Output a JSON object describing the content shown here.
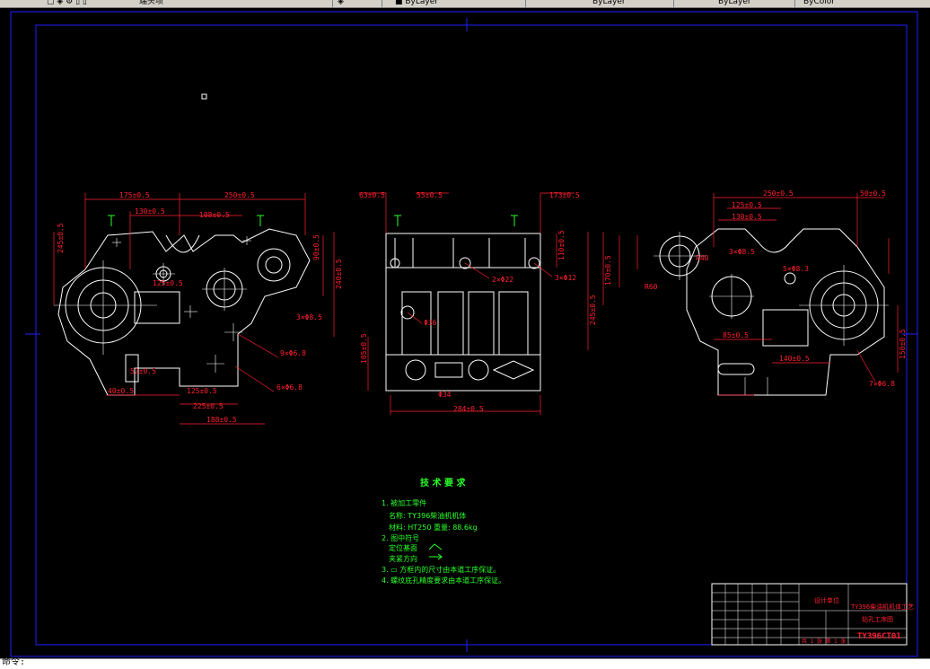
{
  "toolbar": {
    "items": [
      "▢ ◈ ⚙ ▯ ▯",
      "端头项",
      "◈",
      "■ ByLayer",
      "ByLayer",
      "ByLayer",
      "ByColor"
    ]
  },
  "command_line": {
    "prompt": "命令:"
  },
  "drawing": {
    "colors": {
      "outline": "#ffffff",
      "dimension": "#ff2030",
      "center": "#ffffff",
      "tech": "#28ff28",
      "frame": "#2020ff"
    },
    "view1_dims": [
      "175±0.5",
      "250±0.5",
      "130±0.5",
      "108±0.5",
      "125±0.5",
      "245±0.5",
      "240±0.5",
      "90±0.5",
      "52±0.5",
      "40±0.5",
      "125±0.5",
      "225±0.5",
      "188±0.5",
      "9×Φ6.8",
      "6×Φ6.8",
      "3×Φ8.5"
    ],
    "view2_dims": [
      "63±0.5",
      "55±0.5",
      "173±0.5",
      "110±0.5",
      "2×Φ22",
      "3×Φ12",
      "Φ34",
      "Φ36",
      "105±0.5",
      "284±0.5"
    ],
    "view3_dims": [
      "250±0.5",
      "125±0.5",
      "130±0.5",
      "50±0.5",
      "245±0.5",
      "3×Φ8.5",
      "R40",
      "R60",
      "170±0.5",
      "85±0.5",
      "140±0.5",
      "7×Φ6.8",
      "5×Φ8.3",
      "150±0.5"
    ],
    "tech": {
      "title": "技 术 要 求",
      "lines": [
        "1. 被加工零件",
        "名称: TY396柴油机机体",
        "材料: HT250 重量: 88.6kg",
        "2. 图中符号",
        "定位基面",
        "夹紧方向",
        "3. ▭ 方框内的尺寸由本道工序保证。",
        "4. 螺纹底孔精度要求由本道工序保证。"
      ]
    },
    "title_block": {
      "company": "设计单位",
      "name_line1": "TY396柴油机机体工艺",
      "name_line2": "钻孔工序图",
      "drawing_no": "TY396CT01",
      "sheet": "共 1 张 第 1 张"
    }
  }
}
